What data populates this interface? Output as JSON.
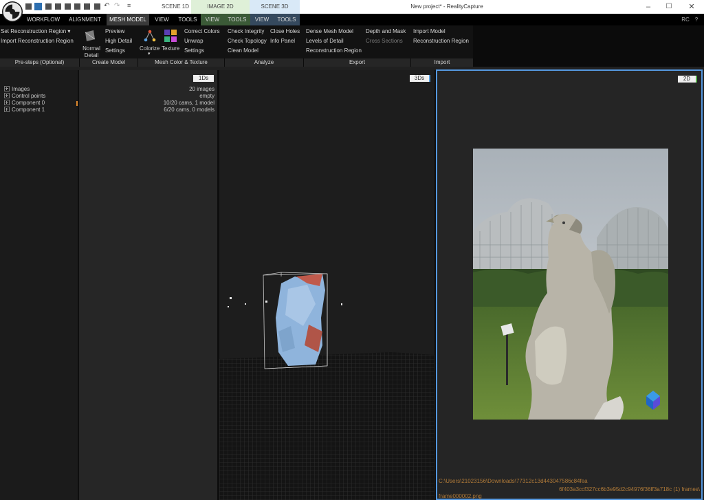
{
  "titlebar": {
    "window_title": "New project* - RealityCapture",
    "tabs": [
      {
        "label": "SCENE 1D",
        "bg": "#ffffff"
      },
      {
        "label": "IMAGE 2D",
        "bg": "#dff0d8"
      },
      {
        "label": "SCENE 3D",
        "bg": "#d9e9f7"
      }
    ],
    "dropdown_glyph": "≡"
  },
  "menubar": {
    "items": [
      "WORKFLOW",
      "ALIGNMENT",
      "MESH MODEL",
      "VIEW",
      "TOOLS",
      "VIEW",
      "TOOLS",
      "VIEW",
      "TOOLS"
    ],
    "active": "MESH MODEL",
    "right": "RC",
    "help": "?"
  },
  "ribbon": {
    "presteps": {
      "set_region": "Set Reconstruction Region",
      "import_region": "Import Reconstruction Region",
      "label": "Pre-steps (Optional)"
    },
    "create": {
      "normal_1": "Normal",
      "normal_2": "Detail",
      "preview": "Preview",
      "high_detail": "High Detail",
      "settings": "Settings",
      "label": "Create Model"
    },
    "color": {
      "colorize": "Colorize",
      "texture": "Texture",
      "correct_colors": "Correct Colors",
      "unwrap": "Unwrap",
      "settings": "Settings",
      "label": "Mesh Color & Texture"
    },
    "analyze": {
      "check_integrity": "Check Integrity",
      "check_topology": "Check Topology",
      "clean_model": "Clean Model",
      "close_holes": "Close Holes",
      "info_panel": "Info Panel",
      "label": "Analyze"
    },
    "export": {
      "dense_mesh": "Dense Mesh Model",
      "lod": "Levels of Detail",
      "recon_region": "Reconstruction Region",
      "depth_mask": "Depth and Mask",
      "cross_sections": "Cross Sections",
      "label": "Export"
    },
    "import": {
      "import_model": "Import Model",
      "recon_region": "Reconstruction Region",
      "label": "Import"
    }
  },
  "panel_1d": {
    "tag": "1Ds",
    "tree": [
      "Images",
      "Control points",
      "Component 0",
      "Component 1"
    ],
    "values": [
      "20 images",
      "empty",
      "10/20 cams, 1 model",
      "6/20 cams, 0 models"
    ]
  },
  "panel_3d": {
    "tag": "3Ds"
  },
  "panel_2d": {
    "tag": "2D",
    "path_1": "C:\\Users\\21023156\\Downloads\\77312c13d443047586c84fea",
    "path_2": "6f403a3ccf327cc6b3e95d2c94976f36ff3a718c (1) frames\\",
    "path_3": "frame000002.png"
  }
}
